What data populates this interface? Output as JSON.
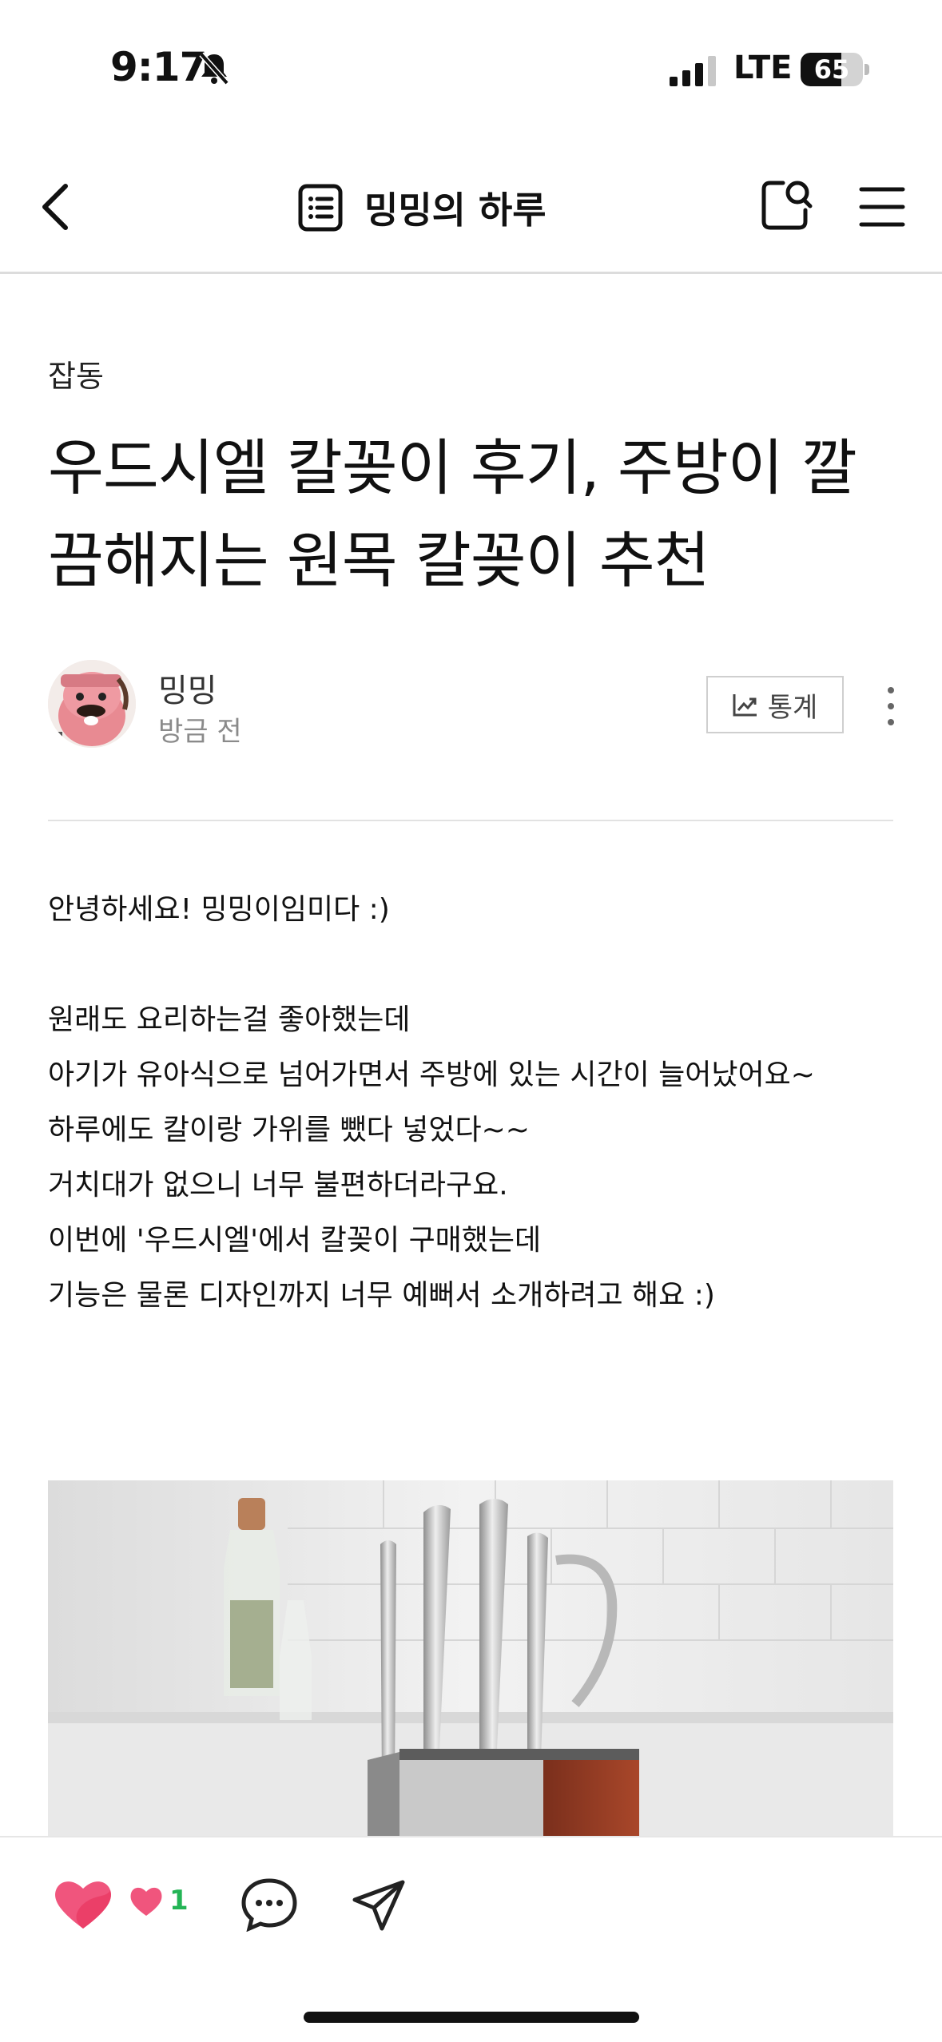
{
  "status": {
    "time": "9:17",
    "network": "LTE",
    "battery_level": "65",
    "battery_percent": 65
  },
  "nav": {
    "blog_title": "밍밍의 하루",
    "icons": [
      "back-arrow",
      "list",
      "search",
      "menu"
    ]
  },
  "post": {
    "category": "잡동",
    "title_line1": "우드시엘 칼꽂이 후기, 주방이 깔",
    "title_line2": "끔해지는 원목 칼꽂이 추천",
    "author": "밍밍",
    "time": "방금 전",
    "stats_label": "통계",
    "body": [
      "안녕하세요! 밍밍이임미다 :)",
      "",
      "원래도 요리하는걸 좋아했는데",
      "아기가 유아식으로 넘어가면서 주방에 있는 시간이 늘어났어요~",
      "하루에도 칼이랑 가위를 뺐다 넣었다~~",
      "거치대가 없으니 너무 불편하더라구요.",
      "이번에 '우드시엘'에서 칼꽂이 구매했는데",
      "기능은 물론 디자인까지 너무 예뻐서 소개하려고 해요 :)"
    ]
  },
  "bottom": {
    "sympathy_count": "1"
  },
  "colors": {
    "heart": "#f0557d",
    "count": "#23b455",
    "divider": "#e2e2e2"
  }
}
